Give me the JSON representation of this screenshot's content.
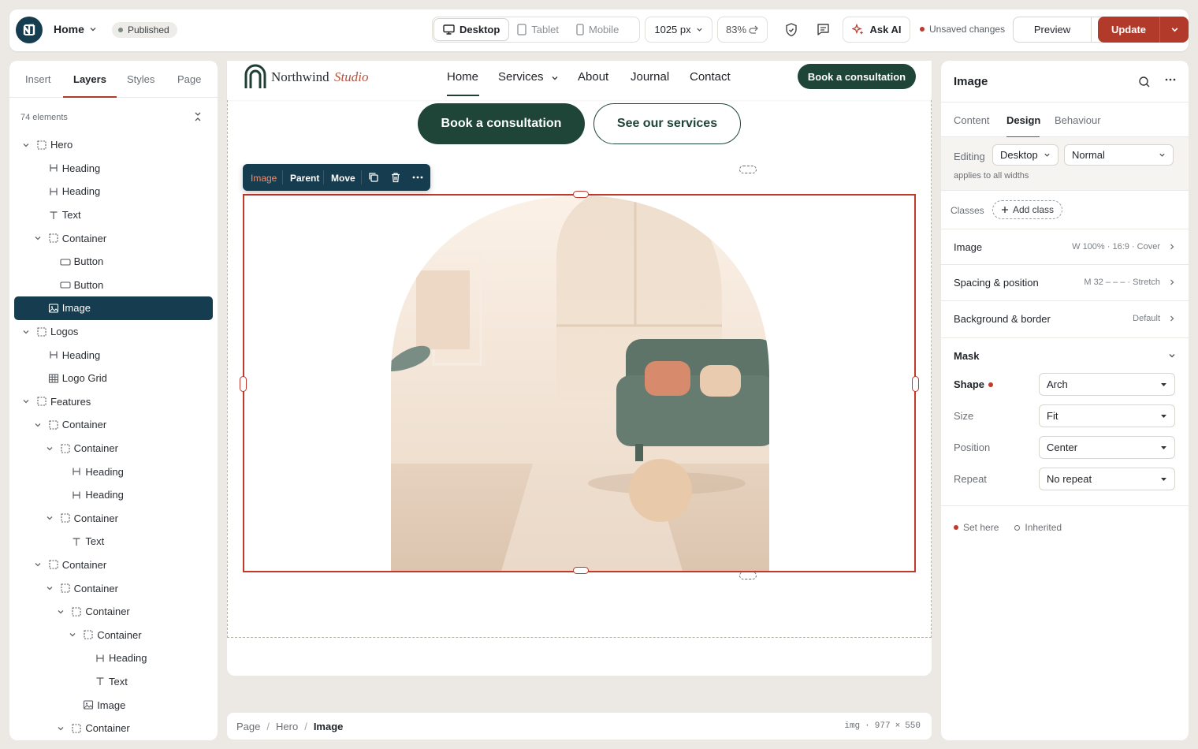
{
  "topbar": {
    "page_name": "Home",
    "status": "Published",
    "devices": [
      {
        "label": "Desktop",
        "icon": "desktop-icon",
        "active": true
      },
      {
        "label": "Tablet",
        "icon": "tablet-icon",
        "active": false
      },
      {
        "label": "Mobile",
        "icon": "mobile-icon",
        "active": false
      }
    ],
    "width": "1025 px",
    "zoom": "83%",
    "ask_ai": "Ask AI",
    "unsaved": "Unsaved changes",
    "preview": "Preview",
    "update": "Update"
  },
  "left_panel": {
    "tabs": [
      "Insert",
      "Layers",
      "Styles",
      "Page"
    ],
    "active_tab": "Layers",
    "element_count": "74 elements",
    "tree": [
      {
        "label": "Hero",
        "type": "container",
        "depth": 0,
        "expandable": true
      },
      {
        "label": "Heading",
        "type": "heading",
        "depth": 1
      },
      {
        "label": "Heading",
        "type": "heading",
        "depth": 1
      },
      {
        "label": "Text",
        "type": "text",
        "depth": 1
      },
      {
        "label": "Container",
        "type": "container",
        "depth": 1,
        "expandable": true
      },
      {
        "label": "Button",
        "type": "button",
        "depth": 2
      },
      {
        "label": "Button",
        "type": "button",
        "depth": 2
      },
      {
        "label": "Image",
        "type": "image",
        "depth": 1,
        "selected": true
      },
      {
        "label": "Logos",
        "type": "container",
        "depth": 0,
        "expandable": true
      },
      {
        "label": "Heading",
        "type": "heading",
        "depth": 1
      },
      {
        "label": "Logo Grid",
        "type": "grid",
        "depth": 1
      },
      {
        "label": "Features",
        "type": "container",
        "depth": 0,
        "expandable": true
      },
      {
        "label": "Container",
        "type": "container",
        "depth": 1,
        "expandable": true
      },
      {
        "label": "Container",
        "type": "container",
        "depth": 2,
        "expandable": true
      },
      {
        "label": "Heading",
        "type": "heading",
        "depth": 3
      },
      {
        "label": "Heading",
        "type": "heading",
        "depth": 3
      },
      {
        "label": "Container",
        "type": "container",
        "depth": 2,
        "expandable": true
      },
      {
        "label": "Text",
        "type": "text",
        "depth": 3
      },
      {
        "label": "Container",
        "type": "container",
        "depth": 1,
        "expandable": true
      },
      {
        "label": "Container",
        "type": "container",
        "depth": 2,
        "expandable": true
      },
      {
        "label": "Container",
        "type": "container",
        "depth": 3,
        "expandable": true
      },
      {
        "label": "Container",
        "type": "container",
        "depth": 4,
        "expandable": true
      },
      {
        "label": "Heading",
        "type": "heading",
        "depth": 5
      },
      {
        "label": "Text",
        "type": "text",
        "depth": 5
      },
      {
        "label": "Image",
        "type": "image",
        "depth": 4
      },
      {
        "label": "Container",
        "type": "container",
        "depth": 3,
        "expandable": true
      }
    ]
  },
  "canvas": {
    "site": {
      "brand": "Northwind",
      "brand_em": "Studio",
      "nav": [
        "Home",
        "Services",
        "About",
        "Journal",
        "Contact"
      ],
      "nav_cta": "Book a consultation",
      "hero_cta_primary": "Book a consultation",
      "hero_cta_secondary": "See our services"
    },
    "toolbar": {
      "image": "Image",
      "parent": "Parent",
      "move": "Move"
    }
  },
  "breadcrumb": {
    "items": [
      "Page",
      "Hero",
      "Image"
    ],
    "tag": "img",
    "width": "977",
    "times": "×",
    "height": "550"
  },
  "right_panel": {
    "title": "Image",
    "tabs": [
      "Content",
      "Design",
      "Behaviour"
    ],
    "active_tab": "Design",
    "editing_label": "Editing",
    "editing_device": "Desktop",
    "editing_state": "Normal",
    "applies": "applies to all widths",
    "classes_label": "Classes",
    "add_class": "Add class",
    "sections": [
      {
        "title": "Image",
        "value": "W 100% · 16:9 · Cover"
      },
      {
        "title": "Spacing & position",
        "value": "M 32 – – – · Stretch"
      },
      {
        "title": "Background & border",
        "value": "Default"
      }
    ],
    "mask": {
      "title": "Mask",
      "props": [
        {
          "label": "Shape",
          "value": "Arch",
          "set": true
        },
        {
          "label": "Size",
          "value": "Fit"
        },
        {
          "label": "Position",
          "value": "Center"
        },
        {
          "label": "Repeat",
          "value": "No repeat"
        }
      ]
    },
    "legend": {
      "set_here": "Set here",
      "inherited": "Inherited"
    }
  },
  "colors": {
    "accent": "#b23a2a",
    "navy": "#163c4f",
    "forest": "#1f4438"
  }
}
